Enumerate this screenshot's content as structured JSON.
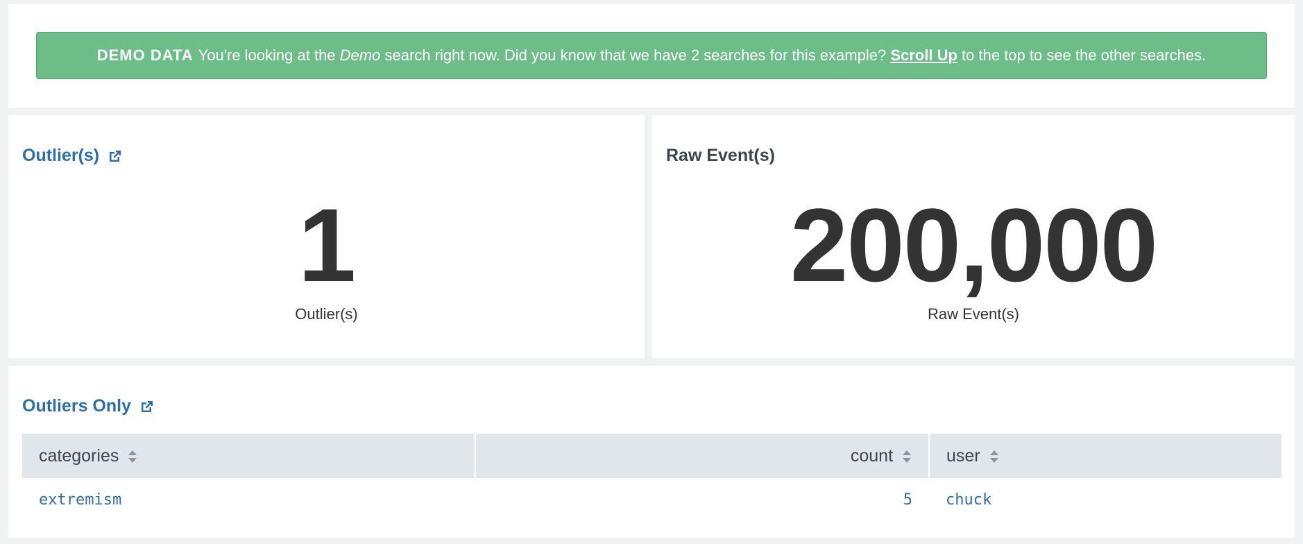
{
  "banner": {
    "label": "DEMO DATA",
    "text_before": "You're looking at the",
    "emphasis": "Demo",
    "text_middle": "search right now. Did you know that we have 2 searches for this example?",
    "link": "Scroll Up",
    "text_after": "to the top to see the other searches.",
    "color": "#6cbd87"
  },
  "outliers_panel": {
    "title": "Outlier(s)",
    "value": "1",
    "caption": "Outlier(s)",
    "icon": "external-link-icon"
  },
  "raw_events_panel": {
    "title": "Raw Event(s)",
    "value": "200,000",
    "caption": "Raw Event(s)"
  },
  "table_panel": {
    "title": "Outliers Only",
    "icon": "external-link-icon",
    "columns": [
      "categories",
      "count",
      "user"
    ],
    "rows": [
      {
        "categories": "extremism",
        "count": "5",
        "user": "chuck"
      }
    ]
  },
  "colors": {
    "link": "#2f6fa7",
    "header_bg": "#e1e6eb",
    "page_bg": "#f1f2f4"
  }
}
